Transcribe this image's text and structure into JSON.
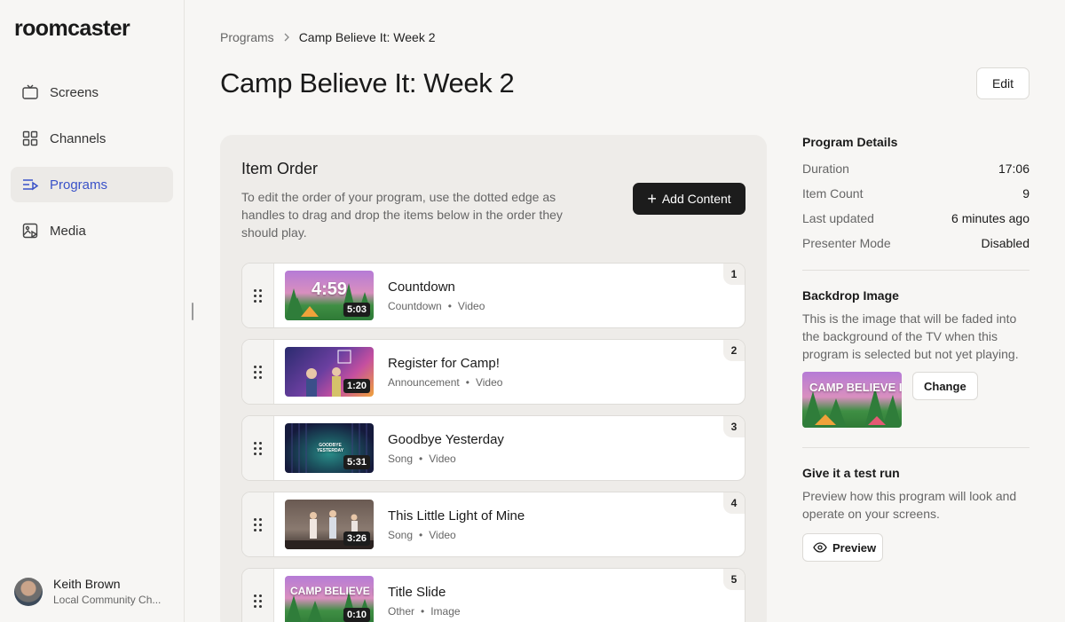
{
  "app": {
    "logo": "roomcaster"
  },
  "sidebar": {
    "items": [
      {
        "label": "Screens",
        "icon": "tv-icon",
        "active": false
      },
      {
        "label": "Channels",
        "icon": "grid-icon",
        "active": false
      },
      {
        "label": "Programs",
        "icon": "playlist-icon",
        "active": true
      },
      {
        "label": "Media",
        "icon": "media-icon",
        "active": false
      }
    ],
    "user": {
      "name": "Keith Brown",
      "org": "Local Community Ch..."
    }
  },
  "breadcrumb": {
    "parent": "Programs",
    "current": "Camp Believe It: Week 2"
  },
  "page": {
    "title": "Camp Believe It: Week 2",
    "edit_label": "Edit"
  },
  "item_order": {
    "title": "Item Order",
    "description": "To edit the order of your program, use the dotted edge as handles to drag and drop the items below in the order they should play.",
    "add_label": "Add Content",
    "items": [
      {
        "index": "1",
        "title": "Countdown",
        "category": "Countdown",
        "type": "Video",
        "duration": "5:03",
        "thumb_text": "4:59"
      },
      {
        "index": "2",
        "title": "Register for Camp!",
        "category": "Announcement",
        "type": "Video",
        "duration": "1:20",
        "thumb_text": ""
      },
      {
        "index": "3",
        "title": "Goodbye Yesterday",
        "category": "Song",
        "type": "Video",
        "duration": "5:31",
        "thumb_text": "GOODBYE YESTERDAY"
      },
      {
        "index": "4",
        "title": "This Little Light of Mine",
        "category": "Song",
        "type": "Video",
        "duration": "3:26",
        "thumb_text": ""
      },
      {
        "index": "5",
        "title": "Title Slide",
        "category": "Other",
        "type": "Image",
        "duration": "0:10",
        "thumb_text": "CAMP BELIEVE IT"
      }
    ]
  },
  "program_details": {
    "title": "Program Details",
    "rows": [
      {
        "key": "Duration",
        "value": "17:06"
      },
      {
        "key": "Item Count",
        "value": "9"
      },
      {
        "key": "Last updated",
        "value": "6 minutes ago"
      },
      {
        "key": "Presenter Mode",
        "value": "Disabled"
      }
    ]
  },
  "backdrop": {
    "title": "Backdrop Image",
    "description": "This is the image that will be faded into the background of the TV when this program is selected but not yet playing.",
    "change_label": "Change",
    "thumb_text": "CAMP BELIEVE IT"
  },
  "test_run": {
    "title": "Give it a test run",
    "description": "Preview how this program will look and operate on your screens.",
    "preview_label": "Preview"
  },
  "colors": {
    "accent": "#3a52c8",
    "primary_button": "#1c1c1c",
    "background": "#f7f6f4"
  }
}
